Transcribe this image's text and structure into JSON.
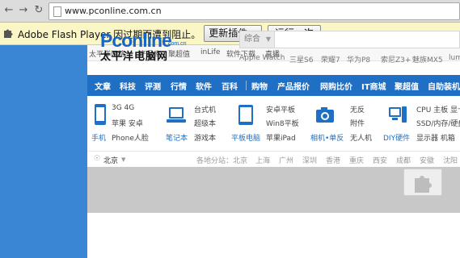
{
  "browser": {
    "address": "www.pconline.com.cn"
  },
  "infobar": {
    "message": "Adobe Flash Player 因过期而遭到阻止。",
    "update_button": "更新插件...",
    "run_button": "运行一次"
  },
  "top_nav": [
    "太平洋网络",
    "产品库",
    "聚超值",
    "inLife",
    "软件下载",
    "直播"
  ],
  "logo": {
    "main": "Pconline",
    "suffix": ".com.cn",
    "cn": "太平洋电脑网"
  },
  "search": {
    "select": "综合"
  },
  "hot_words": [
    "Apple Watch",
    "三星S6",
    "荣耀7",
    "华为P8",
    "索尼Z3+",
    "魅族MX5",
    "lum"
  ],
  "category_nav": [
    "文章",
    "科技",
    "评测",
    "行情",
    "软件",
    "百科",
    "购物",
    "产品报价",
    "网购比价",
    "IT商城",
    "聚超值",
    "自助装机"
  ],
  "product_groups": [
    {
      "caption": "手机",
      "links": [
        "3G 4G",
        "苹果 安卓",
        "Phone人脸"
      ]
    },
    {
      "caption": "笔记本",
      "links": [
        "台式机",
        "超级本",
        "游戏本"
      ]
    },
    {
      "caption": "平板电脑",
      "links": [
        "安卓平板",
        "Win8平板",
        "苹果iPad"
      ]
    },
    {
      "caption": "相机•单反",
      "links": [
        "无反",
        "附件",
        "无人机"
      ]
    },
    {
      "caption": "DIY硬件",
      "links": [
        "CPU 主板 显卡",
        "SSD/内存/硬盘",
        "显示器 机箱"
      ]
    }
  ],
  "region": {
    "current": "北京",
    "label": "各地分站：",
    "cities": [
      "北京",
      "上海",
      "广州",
      "深圳",
      "香港",
      "重庆",
      "西安",
      "成都",
      "安徽",
      "沈阳"
    ]
  },
  "colors": {
    "left_panel": "#3a85d4",
    "nav_blue": "#1f6fc5",
    "infobar": "#fbf6c6"
  }
}
